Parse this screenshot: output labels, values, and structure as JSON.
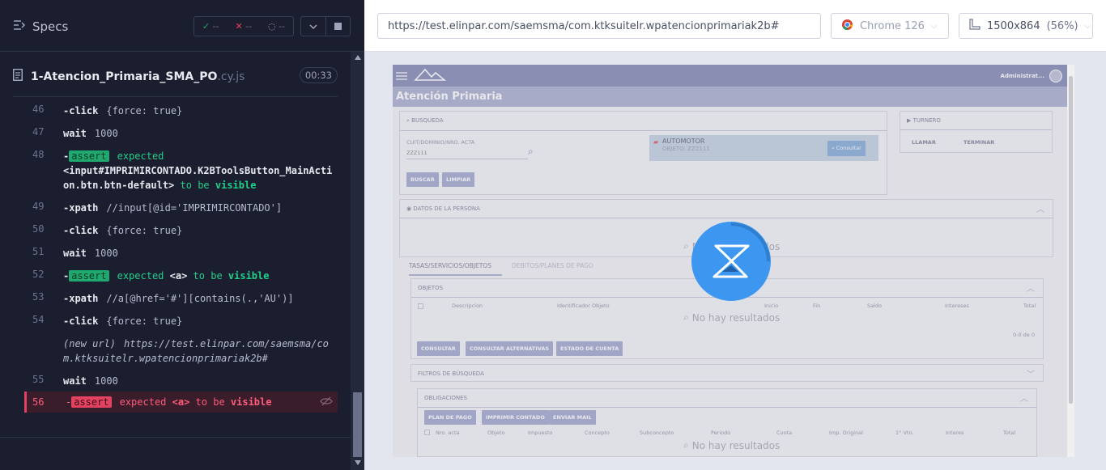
{
  "runner": {
    "specs_label": "Specs",
    "stats": {
      "passed": "--",
      "failed": "--",
      "pending": "--"
    },
    "file": {
      "name": "1-Atencion_Primaria_SMA_PO",
      "ext": ".cy.js",
      "duration": "00:33"
    },
    "commands": [
      {
        "num": "46",
        "kind": "click",
        "cmd": "-click",
        "arg": "{force: true}"
      },
      {
        "num": "47",
        "kind": "wait",
        "cmd": "wait",
        "arg": "1000"
      },
      {
        "num": "48",
        "kind": "assert",
        "cmd": "-assert",
        "text": "expected",
        "subject": "<input#IMPRIMIRCONTADO.K2BToolsButton_MainAction.btn.btn-default>",
        "tobe": "to be",
        "state": "visible"
      },
      {
        "num": "49",
        "kind": "xpath",
        "cmd": "-xpath",
        "arg": "//input[@id='IMPRIMIRCONTADO']"
      },
      {
        "num": "50",
        "kind": "click",
        "cmd": "-click",
        "arg": "{force: true}"
      },
      {
        "num": "51",
        "kind": "wait",
        "cmd": "wait",
        "arg": "1000"
      },
      {
        "num": "52",
        "kind": "assert",
        "cmd": "-assert",
        "text": "expected",
        "subject": "<a>",
        "tobe": "to be",
        "state": "visible"
      },
      {
        "num": "53",
        "kind": "xpath",
        "cmd": "-xpath",
        "arg": "//a[@href='#'][contains(.,'AU')]"
      },
      {
        "num": "54",
        "kind": "click",
        "cmd": "-click",
        "arg": "{force: true}"
      },
      {
        "num": "",
        "kind": "newurl",
        "cmd": "(new url)",
        "arg": "https://test.elinpar.com/saemsma/com.ktksuitelr.wpatencionprimariak2b#"
      },
      {
        "num": "55",
        "kind": "wait",
        "cmd": "wait",
        "arg": "1000"
      },
      {
        "num": "56",
        "kind": "fail",
        "cmd": "-assert",
        "text": "expected",
        "subject": "<a>",
        "tobe": "to be",
        "state": "visible"
      }
    ]
  },
  "browserbar": {
    "url": "https://test.elinpar.com/saemsma/com.ktksuitelr.wpatencionprimariak2b#",
    "browser": "Chrome 126",
    "viewport": "1500x864",
    "zoom": "(56%)"
  },
  "app": {
    "user": "Administrat...",
    "title": "Atención Primaria",
    "busqueda": {
      "title": "BUSQUEDA",
      "field_label": "CUIT/DOMINIO/NRO. ACTA",
      "field_value": "ZZZ111",
      "automotor": "AUTOMOTOR",
      "objeto": "OBJETO: ZZZ111",
      "consultar": "Consultar",
      "buscar": "BUSCAR",
      "limpiar": "LIMPIAR"
    },
    "turnero": {
      "title": "TURNERO",
      "llamar": "LLAMAR",
      "terminar": "TERMINAR"
    },
    "persona": {
      "title": "DATOS DE LA PERSONA",
      "no_results": "No hay resultados"
    },
    "tabs": {
      "t1": "TASAS/SERVICIOS/OBJETOS",
      "t2": "DEBITOS/PLANES DE PAGO"
    },
    "objetos": {
      "title": "OBJETOS",
      "columns": [
        "Descripcion",
        "Identificador Objeto",
        "Inicio",
        "Fin",
        "Saldo",
        "Intereses",
        "Total"
      ],
      "no_results": "No hay resultados",
      "count": "0-0 de 0",
      "btn1": "CONSULTAR",
      "btn2": "CONSULTAR ALTERNATIVAS",
      "btn3": "ESTADO DE CUENTA"
    },
    "filtros": {
      "title": "FILTROS DE BÚSQUEDA"
    },
    "obligaciones": {
      "title": "OBLIGACIONES",
      "btn1": "PLAN DE PAGO",
      "btn2": "IMPRIMIR CONTADO",
      "btn3": "ENVIAR MAIL",
      "columns": [
        "Nro. acta",
        "Objeto",
        "Impuesto",
        "Concepto",
        "Subconcepto",
        "Periodo",
        "Cuota",
        "Imp. Original",
        "1° Vto.",
        "Interes",
        "Total"
      ],
      "no_results": "No hay resultados"
    }
  },
  "colors": {
    "pass": "#1fa971",
    "fail": "#e44261",
    "spinner": "#3d97f0"
  }
}
